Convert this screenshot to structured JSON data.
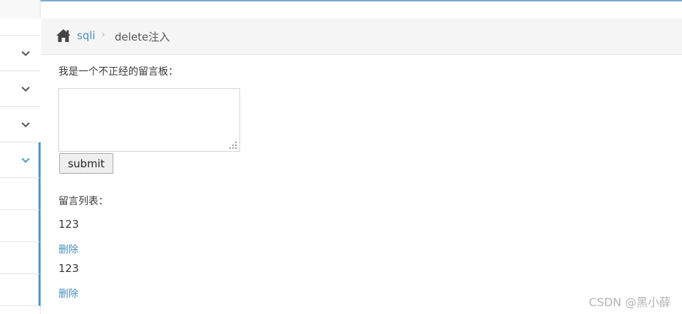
{
  "breadcrumb": {
    "home_icon": "home-icon",
    "link_label": "sqli",
    "separator": "›",
    "current": "delete注入"
  },
  "sidebar": {
    "icons": [
      "chevron-down-icon",
      "chevron-down-icon",
      "chevron-down-icon",
      "chevron-down-icon"
    ],
    "colors": {
      "chevron": "#555555",
      "active_chevron": "#4f99c6",
      "active_border": "#4f99c6"
    }
  },
  "form": {
    "board_label": "我是一个不正经的留言板：",
    "textarea_value": "",
    "submit_label": "submit"
  },
  "messages": {
    "list_label": "留言列表：",
    "items": [
      {
        "text": "123",
        "delete_label": "删除"
      },
      {
        "text": "123",
        "delete_label": "删除"
      }
    ]
  },
  "watermark": "CSDN @黑小薛",
  "colors": {
    "link": "#4c8fbd",
    "text": "#393939",
    "breadcrumb_bg": "#f5f5f5"
  }
}
